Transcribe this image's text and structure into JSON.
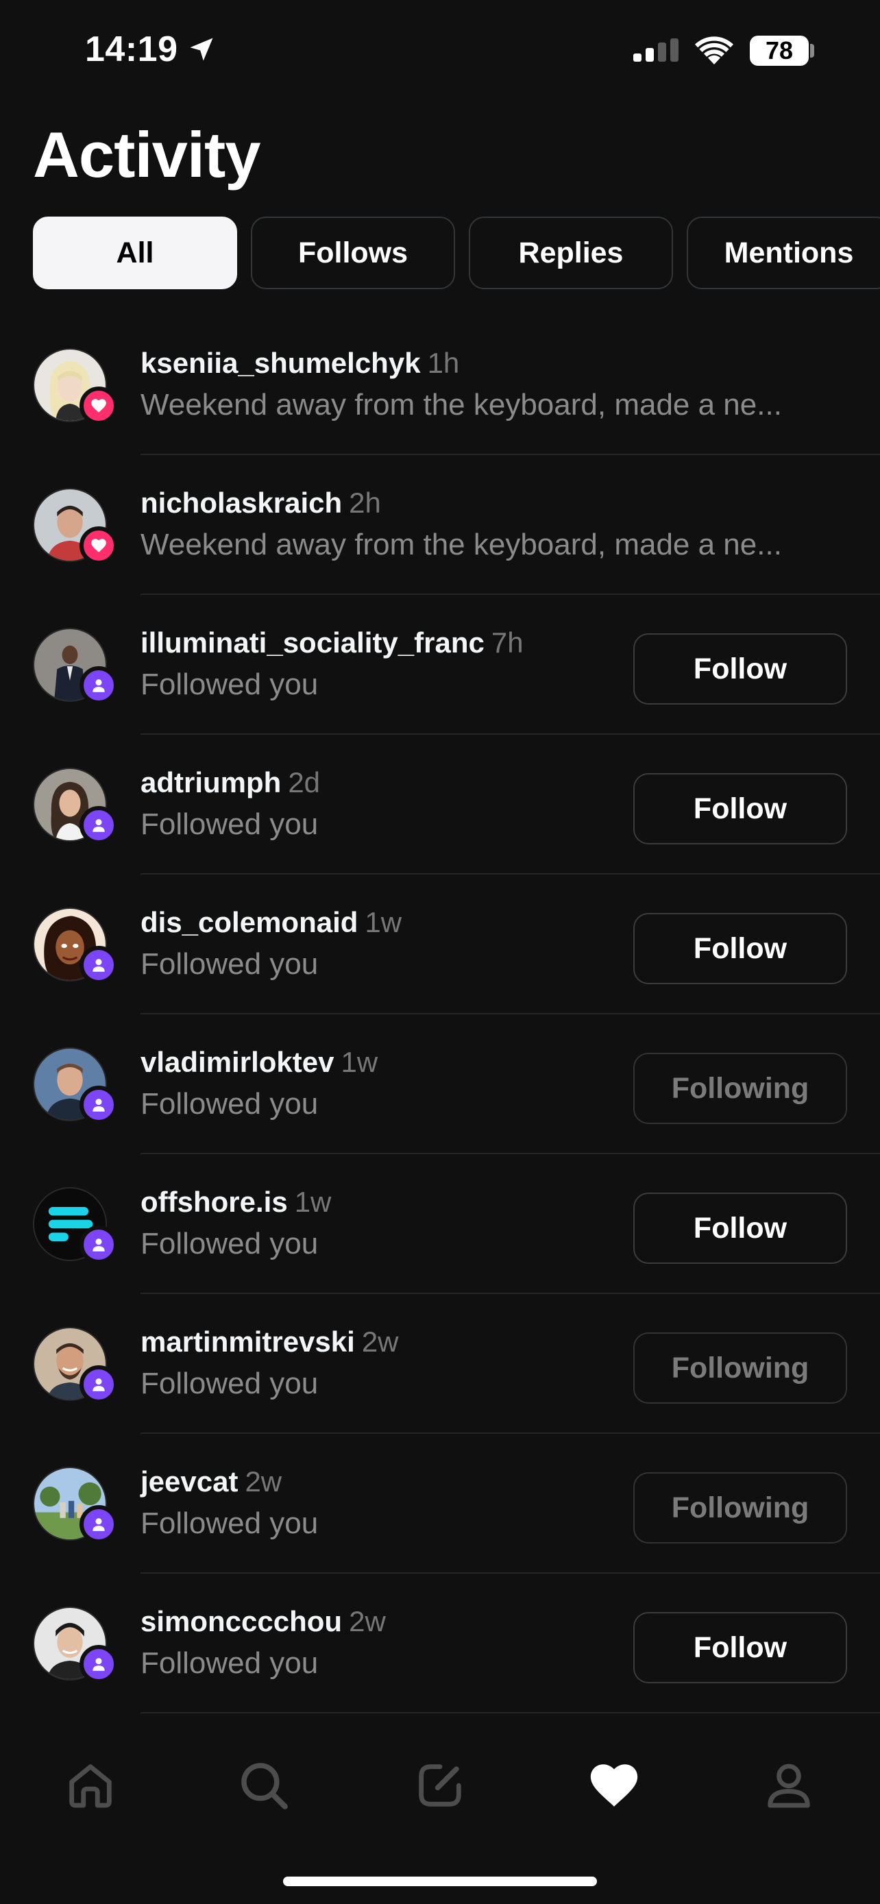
{
  "status_bar": {
    "time": "14:19",
    "battery": "78",
    "icons": [
      "location-arrow-icon",
      "signal-icon",
      "wifi-icon",
      "battery-icon"
    ]
  },
  "page": {
    "title": "Activity"
  },
  "tabs": [
    {
      "label": "All",
      "active": true
    },
    {
      "label": "Follows",
      "active": false
    },
    {
      "label": "Replies",
      "active": false
    },
    {
      "label": "Mentions",
      "active": false
    }
  ],
  "activity": [
    {
      "username": "kseniia_shumelchyk",
      "time": "1h",
      "text": "Weekend away from the keyboard, made a ne...",
      "badge": "heart-icon",
      "action": ""
    },
    {
      "username": "nicholaskraich",
      "time": "2h",
      "text": "Weekend away from the keyboard, made a ne...",
      "badge": "heart-icon",
      "action": ""
    },
    {
      "username": "illuminati_sociality_franc",
      "time": "7h",
      "text": "Followed you",
      "badge": "person-icon",
      "action": "Follow"
    },
    {
      "username": "adtriumph",
      "time": "2d",
      "text": "Followed you",
      "badge": "person-icon",
      "action": "Follow"
    },
    {
      "username": "dis_colemonaid",
      "time": "1w",
      "text": "Followed you",
      "badge": "person-icon",
      "action": "Follow"
    },
    {
      "username": "vladimirloktev",
      "time": "1w",
      "text": "Followed you",
      "badge": "person-icon",
      "action": "Following"
    },
    {
      "username": "offshore.is",
      "time": "1w",
      "text": "Followed you",
      "badge": "person-icon",
      "action": "Follow"
    },
    {
      "username": "martinmitrevski",
      "time": "2w",
      "text": "Followed you",
      "badge": "person-icon",
      "action": "Following"
    },
    {
      "username": "jeevcat",
      "time": "2w",
      "text": "Followed you",
      "badge": "person-icon",
      "action": "Following"
    },
    {
      "username": "simoncccchou",
      "time": "2w",
      "text": "Followed you",
      "badge": "person-icon",
      "action": "Follow"
    }
  ],
  "bottom_nav": {
    "items": [
      "home-icon",
      "search-icon",
      "compose-icon",
      "heart-icon",
      "profile-icon"
    ],
    "active": "heart-icon"
  },
  "colors": {
    "background": "#101010",
    "like_badge": "#ff2f6e",
    "follow_badge": "#7c45f5",
    "muted_text": "#8b8b8b"
  }
}
